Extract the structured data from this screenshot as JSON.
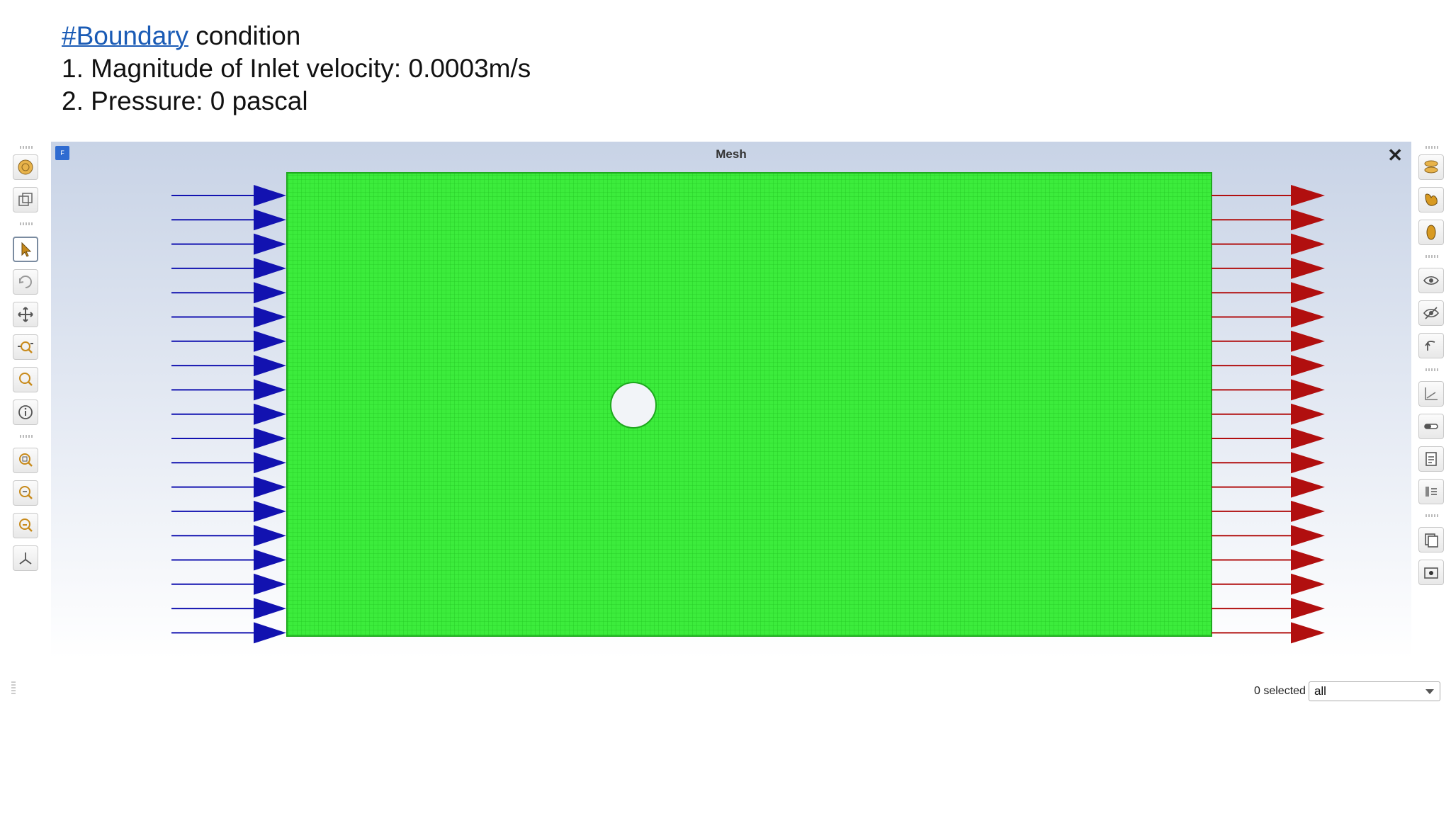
{
  "heading": {
    "hashtag": "#Boundary",
    "title_rest": " condition",
    "line1": "1. Magnitude of Inlet velocity: 0.0003m/s",
    "line2": "2. Pressure: 0 pascal"
  },
  "window": {
    "badge": "F",
    "title": "Mesh",
    "close": "✕"
  },
  "left_toolbar": [
    "mesh-display-icon",
    "3d-view-icon",
    "pointer-icon",
    "rotate-icon",
    "pan-icon",
    "zoom-in-out-icon",
    "zoom-icon",
    "info-icon",
    "fit-view-icon",
    "zoom-box-icon",
    "zoom-out-icon",
    "axes-icon"
  ],
  "right_toolbar": [
    "surface-icon",
    "contour-icon",
    "vector-icon",
    "show-icon",
    "hide-icon",
    "undo-view-icon",
    "plot-icon",
    "colormap-icon",
    "report-icon",
    "legend-icon",
    "copy-icon",
    "screenshot-icon"
  ],
  "colors": {
    "mesh": "#33e633",
    "inlet_arrow": "#1212b0",
    "outlet_arrow": "#b10f0f",
    "accent": "#1a5bb5"
  },
  "status": {
    "selected": "0 selected",
    "filter_value": "all"
  }
}
